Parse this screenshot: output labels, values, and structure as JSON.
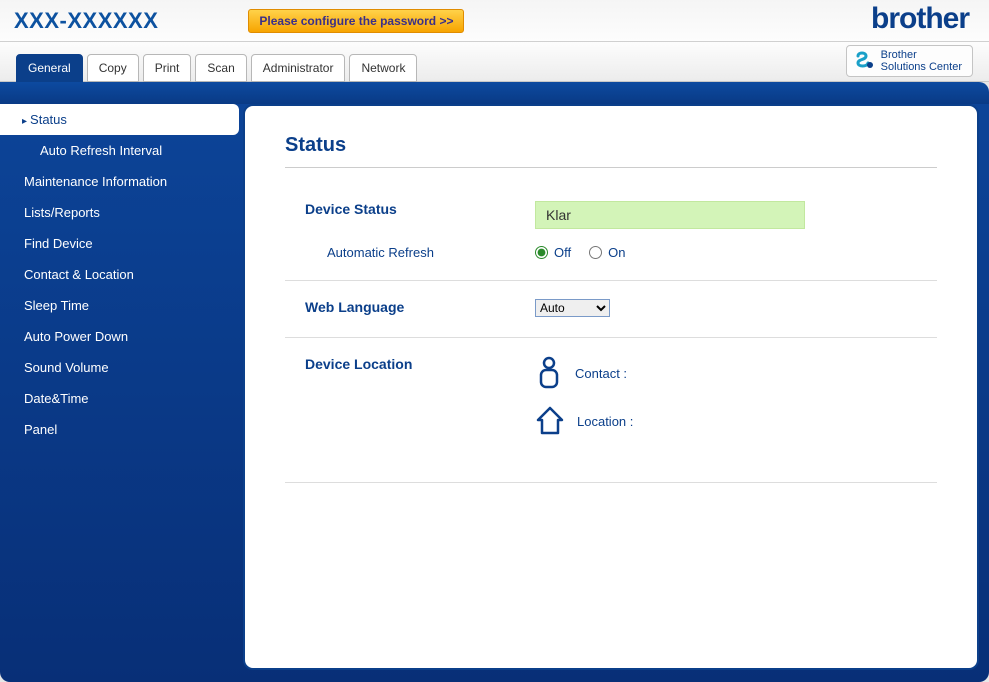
{
  "header": {
    "model": "XXX-XXXXXX",
    "password_notice": "Please configure the password >>",
    "logo_text": "brother",
    "solutions_center_line1": "Brother",
    "solutions_center_line2": "Solutions Center"
  },
  "tabs": {
    "general": "General",
    "copy": "Copy",
    "print": "Print",
    "scan": "Scan",
    "administrator": "Administrator",
    "network": "Network",
    "active": "general"
  },
  "sidebar": {
    "status": "Status",
    "auto_refresh_interval": "Auto Refresh Interval",
    "maintenance_info": "Maintenance Information",
    "lists_reports": "Lists/Reports",
    "find_device": "Find Device",
    "contact_location": "Contact & Location",
    "sleep_time": "Sleep Time",
    "auto_power_down": "Auto Power Down",
    "sound_volume": "Sound Volume",
    "date_time": "Date&Time",
    "panel": "Panel"
  },
  "page": {
    "title": "Status",
    "device_status_label": "Device Status",
    "device_status_value": "Klar",
    "automatic_refresh_label": "Automatic Refresh",
    "refresh_off": "Off",
    "refresh_on": "On",
    "refresh_selected": "off",
    "web_language_label": "Web Language",
    "web_language_value": "Auto",
    "web_language_options": [
      "Auto"
    ],
    "device_location_label": "Device Location",
    "contact_label": "Contact :",
    "contact_value": "",
    "location_label": "Location :",
    "location_value": ""
  }
}
